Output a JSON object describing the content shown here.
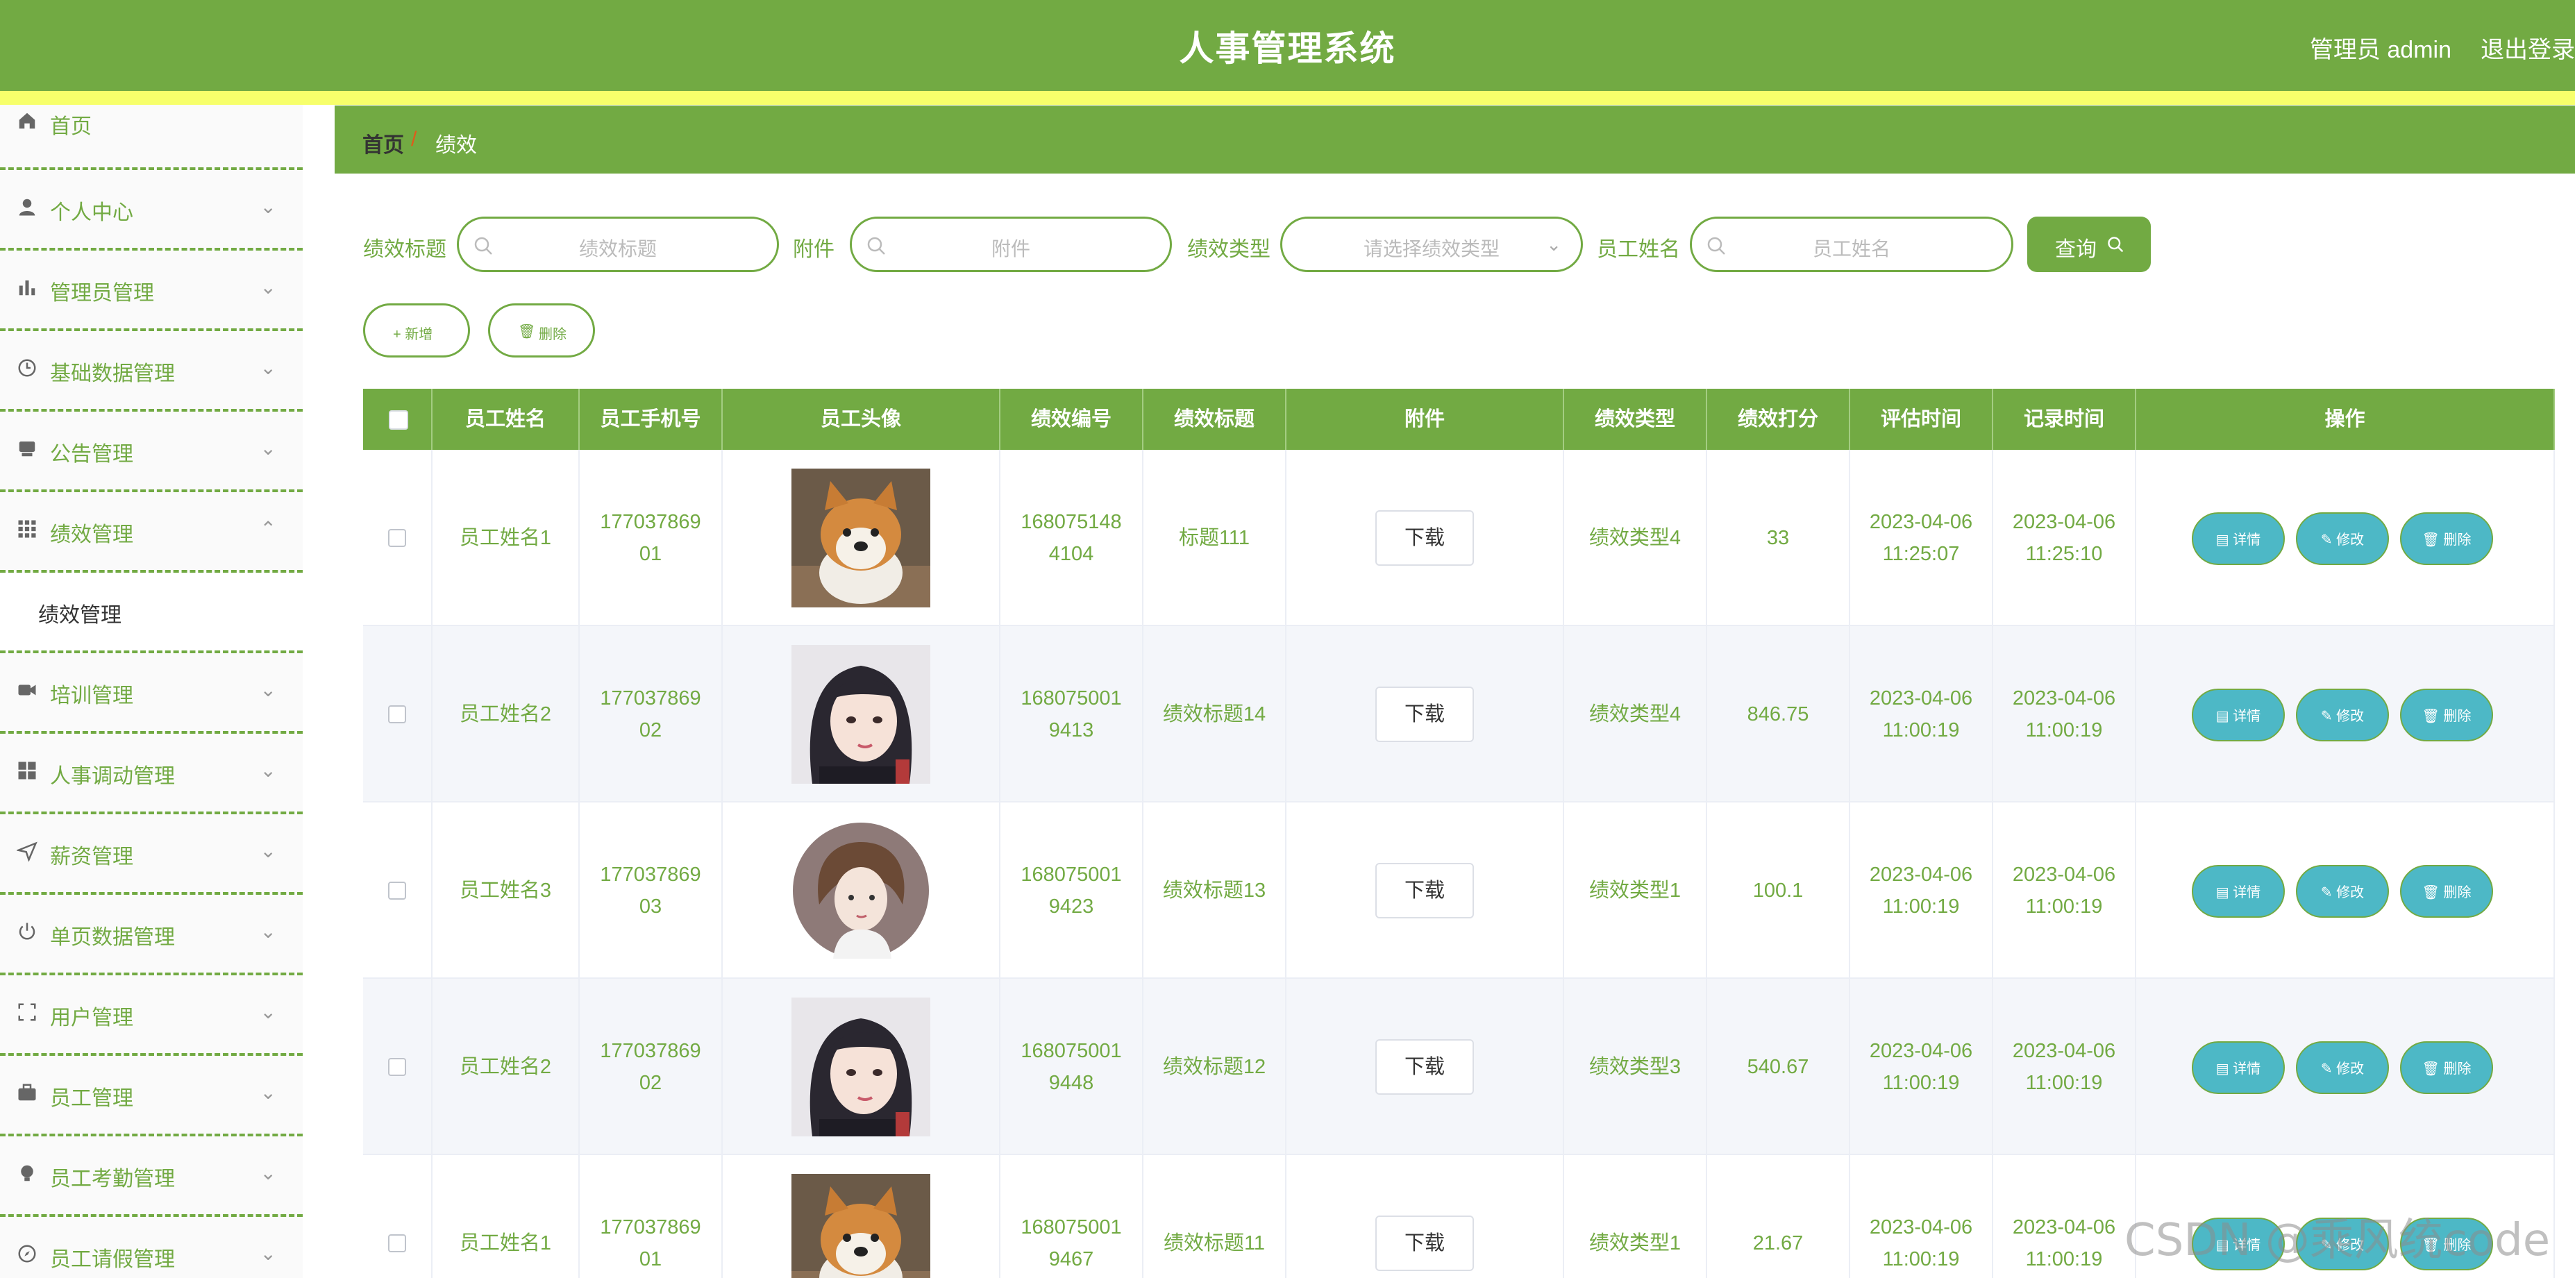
{
  "header": {
    "title": "人事管理系统",
    "user_label": "管理员 admin",
    "logout_label": "退出登录"
  },
  "sidebar": {
    "items": [
      {
        "label": "首页",
        "icon": "home-icon",
        "arrow": ""
      },
      {
        "label": "个人中心",
        "icon": "user-icon",
        "arrow": "⌄"
      },
      {
        "label": "管理员管理",
        "icon": "bar-chart-icon",
        "arrow": "⌄"
      },
      {
        "label": "基础数据管理",
        "icon": "clock-icon",
        "arrow": "⌄"
      },
      {
        "label": "公告管理",
        "icon": "inbox-icon",
        "arrow": "⌄"
      },
      {
        "label": "绩效管理",
        "icon": "grid-icon",
        "arrow": "⌃"
      },
      {
        "label": "培训管理",
        "icon": "video-icon",
        "arrow": "⌄"
      },
      {
        "label": "人事调动管理",
        "icon": "apps-icon",
        "arrow": "⌄"
      },
      {
        "label": "薪资管理",
        "icon": "send-icon",
        "arrow": "⌄"
      },
      {
        "label": "单页数据管理",
        "icon": "power-icon",
        "arrow": "⌄"
      },
      {
        "label": "用户管理",
        "icon": "fullscreen-icon",
        "arrow": "⌄"
      },
      {
        "label": "员工管理",
        "icon": "briefcase-icon",
        "arrow": "⌄"
      },
      {
        "label": "员工考勤管理",
        "icon": "bulb-icon",
        "arrow": "⌄"
      },
      {
        "label": "员工请假管理",
        "icon": "compass-icon",
        "arrow": "⌄"
      }
    ],
    "submenu_label": "绩效管理"
  },
  "breadcrumb": {
    "home": "首页",
    "separator": "/",
    "current": "绩效"
  },
  "search": {
    "title_label": "绩效标题",
    "title_placeholder": "绩效标题",
    "attach_label": "附件",
    "attach_placeholder": "附件",
    "type_label": "绩效类型",
    "type_placeholder": "请选择绩效类型",
    "name_label": "员工姓名",
    "name_placeholder": "员工姓名",
    "query_label": "查询"
  },
  "actions": {
    "add_label": "+ 新增",
    "delete_label": "删除"
  },
  "table": {
    "headers": [
      "员工姓名",
      "员工手机号",
      "员工头像",
      "绩效编号",
      "绩效标题",
      "附件",
      "绩效类型",
      "绩效打分",
      "评估时间",
      "记录时间",
      "操作"
    ],
    "download_label": "下载",
    "detail_label": "详情",
    "edit_label": "修改",
    "remove_label": "删除",
    "rows": [
      {
        "name": "员工姓名1",
        "phone1": "177037869",
        "phone2": "01",
        "avatar": "dog",
        "code1": "168075148",
        "code2": "4104",
        "title": "标题111",
        "type": "绩效类型4",
        "score": "33",
        "eval_date": "2023-04-06",
        "eval_time": "11:25:07",
        "rec_date": "2023-04-06",
        "rec_time": "11:25:10"
      },
      {
        "name": "员工姓名2",
        "phone1": "177037869",
        "phone2": "02",
        "avatar": "girl",
        "code1": "168075001",
        "code2": "9413",
        "title": "绩效标题14",
        "type": "绩效类型4",
        "score": "846.75",
        "eval_date": "2023-04-06",
        "eval_time": "11:00:19",
        "rec_date": "2023-04-06",
        "rec_time": "11:00:19"
      },
      {
        "name": "员工姓名3",
        "phone1": "177037869",
        "phone2": "03",
        "avatar": "cartoon",
        "code1": "168075001",
        "code2": "9423",
        "title": "绩效标题13",
        "type": "绩效类型1",
        "score": "100.1",
        "eval_date": "2023-04-06",
        "eval_time": "11:00:19",
        "rec_date": "2023-04-06",
        "rec_time": "11:00:19"
      },
      {
        "name": "员工姓名2",
        "phone1": "177037869",
        "phone2": "02",
        "avatar": "girl",
        "code1": "168075001",
        "code2": "9448",
        "title": "绩效标题12",
        "type": "绩效类型3",
        "score": "540.67",
        "eval_date": "2023-04-06",
        "eval_time": "11:00:19",
        "rec_date": "2023-04-06",
        "rec_time": "11:00:19"
      },
      {
        "name": "员工姓名1",
        "phone1": "177037869",
        "phone2": "01",
        "avatar": "dog",
        "code1": "168075001",
        "code2": "9467",
        "title": "绩效标题11",
        "type": "绩效类型1",
        "score": "21.67",
        "eval_date": "2023-04-06",
        "eval_time": "11:00:19",
        "rec_date": "2023-04-06",
        "rec_time": "11:00:19"
      }
    ]
  },
  "watermark": "CSDN @乘风统code",
  "colors": {
    "accent": "#72aa43",
    "stripe": "#f7ff6b",
    "op_button": "#4db8c6"
  }
}
